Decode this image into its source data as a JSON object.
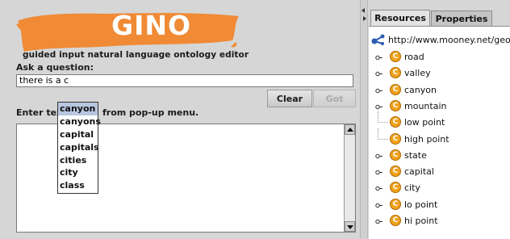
{
  "app": {
    "logo_title": "GINO",
    "logo_subtitle": "guided input natural language ontology editor",
    "brand_color": "#f08a35"
  },
  "question": {
    "label": "Ask a question:",
    "value": "there is a c"
  },
  "buttons": {
    "clear": "Clear",
    "go": "Got"
  },
  "instruction": {
    "prefix": "Enter text",
    "suffix": "from pop-up menu."
  },
  "popup": {
    "items": [
      "canyon",
      "canyons",
      "capital",
      "capitals",
      "cities",
      "city",
      "class"
    ],
    "selected_index": 0
  },
  "right_panel": {
    "tabs": [
      {
        "label": "Resources",
        "active": true
      },
      {
        "label": "Properties",
        "active": false
      }
    ],
    "root": {
      "label": "http://www.mooney.net/geo#",
      "icon": "ontology-icon"
    },
    "nodes": [
      {
        "label": "road",
        "expandable": true,
        "icon": "class-icon"
      },
      {
        "label": "valley",
        "expandable": true,
        "icon": "class-icon"
      },
      {
        "label": "canyon",
        "expandable": true,
        "icon": "class-icon"
      },
      {
        "label": "mountain",
        "expandable": true,
        "icon": "class-icon"
      },
      {
        "label": "low point",
        "expandable": false,
        "icon": "class-icon"
      },
      {
        "label": "high point",
        "expandable": false,
        "icon": "class-icon"
      },
      {
        "label": "state",
        "expandable": true,
        "icon": "class-icon"
      },
      {
        "label": "capital",
        "expandable": true,
        "icon": "class-icon"
      },
      {
        "label": "city",
        "expandable": true,
        "icon": "class-icon"
      },
      {
        "label": "lo point",
        "expandable": true,
        "icon": "class-icon"
      },
      {
        "label": "hi point",
        "expandable": true,
        "icon": "class-icon"
      }
    ],
    "class_glyph": "C"
  }
}
